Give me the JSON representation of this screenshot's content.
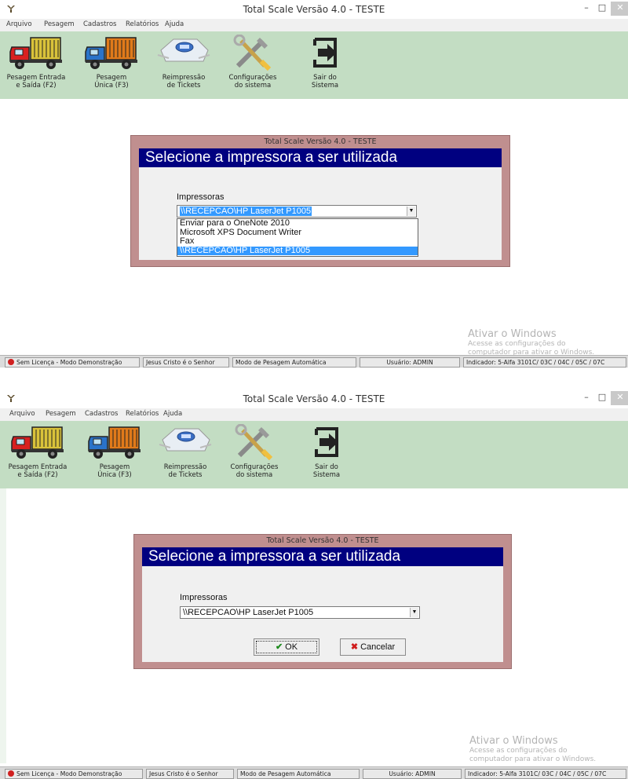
{
  "window": {
    "title": "Total Scale Versão 4.0  -  TESTE",
    "minimize": "–",
    "maximize": "□",
    "close": "✕"
  },
  "menu": [
    "Arquivo",
    "Pesagem",
    "Cadastros",
    "Relatórios",
    "Ajuda"
  ],
  "toolbar": [
    {
      "label": "Pesagem Entrada\ne Saída (F2)",
      "icon": "red-truck-icon"
    },
    {
      "label": "Pesagem\nÚnica (F3)",
      "icon": "blue-truck-icon"
    },
    {
      "label": "Reimpressão\nde Tickets",
      "icon": "printer-icon"
    },
    {
      "label": "Configurações\ndo sistema",
      "icon": "tools-icon"
    },
    {
      "label": "Sair do\nSistema",
      "icon": "exit-icon"
    }
  ],
  "dialog": {
    "title": "Total Scale Versão 4.0  -  TESTE",
    "header": "Selecione a impressora a ser utilizada",
    "field_label": "Impressoras",
    "selected_printer": "\\\\RECEPCAO\\HP LaserJet P1005",
    "printers": [
      "Enviar para o OneNote 2010",
      "Microsoft XPS Document Writer",
      "Fax",
      "\\\\RECEPCAO\\HP LaserJet P1005"
    ],
    "ok_label": "OK",
    "cancel_label": "Cancelar"
  },
  "watermark": {
    "title": "Ativar o Windows",
    "line1": "Acesse as configurações do",
    "line2": "computador para ativar o Windows."
  },
  "status": {
    "license": "Sem Licença - Modo Demonstração",
    "motto": "Jesus Cristo é o Senhor",
    "mode": "Modo de Pesagem Automática",
    "user": "Usuário: ADMIN",
    "indicator": "Indicador: 5-Alfa 3101C/ 03C / 04C / 05C / 07C"
  },
  "colors": {
    "toolbar_bg": "#c3ddc3",
    "dialog_frame": "#c08f8f",
    "dialog_header": "#000080",
    "selection": "#3399ff"
  }
}
